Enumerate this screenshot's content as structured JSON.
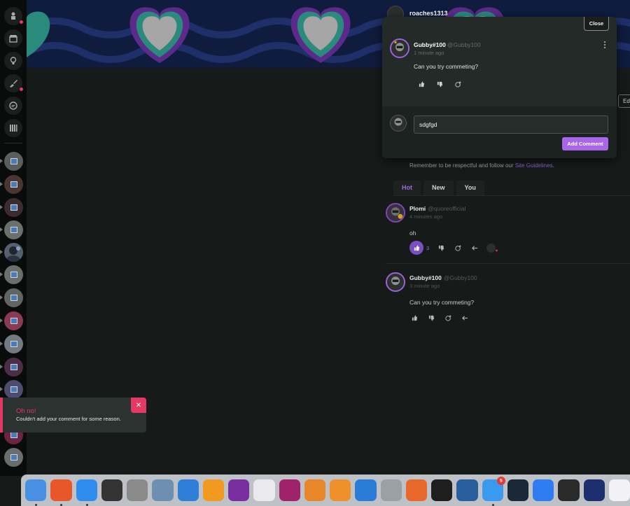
{
  "profile": {
    "username": "roaches1313",
    "edit_label": "Ed"
  },
  "popup": {
    "close_label": "Close",
    "comment": {
      "author": "Gubby#100",
      "handle": "@Gubby100",
      "time": "1 minute ago",
      "text": "Can you try commeting?"
    },
    "input_value": "sdgfgd",
    "add_label": "Add Comment"
  },
  "guidelines": {
    "text": "Remember to be respectful and follow our",
    "link": "Site Guidelines",
    "suffix": "."
  },
  "tabs": [
    {
      "label": "Hot"
    },
    {
      "label": "New"
    },
    {
      "label": "You"
    }
  ],
  "comments": [
    {
      "author": "Plomi",
      "handle": "@quoreofficial",
      "time": "4 minutes ago",
      "text": "oh",
      "likes": "3"
    },
    {
      "author": "Gubby#100",
      "handle": "@Gubby100",
      "time": "3 minute ago",
      "text": "Can you try commeting?"
    }
  ],
  "toast": {
    "title": "Oh no!",
    "message": "Couldn't add your comment for some reason.",
    "close": "✕"
  },
  "dock": {
    "apps": [
      {
        "name": "finder",
        "color": "#4a90e2"
      },
      {
        "name": "firefox",
        "color": "#e8572a"
      },
      {
        "name": "safari",
        "color": "#2f8df0"
      },
      {
        "name": "fl-studio",
        "color": "#333333"
      },
      {
        "name": "calculator",
        "color": "#8a8a8a"
      },
      {
        "name": "preview",
        "color": "#6f8fb0"
      },
      {
        "name": "headphones",
        "color": "#2f7fd8"
      },
      {
        "name": "audacity",
        "color": "#f29a1f"
      },
      {
        "name": "hexagon-app",
        "color": "#7a2fa0"
      },
      {
        "name": "infinity-app",
        "color": "#e9e9ee"
      },
      {
        "name": "monitor-app",
        "color": "#a0226a"
      },
      {
        "name": "blender",
        "color": "#e8872a"
      },
      {
        "name": "sublime-text",
        "color": "#f0902a"
      },
      {
        "name": "vscode",
        "color": "#2b7cd6"
      },
      {
        "name": "disk-utility",
        "color": "#9aa0a6"
      },
      {
        "name": "apex-app",
        "color": "#e8672a"
      },
      {
        "name": "terminal",
        "color": "#1e1e1e"
      },
      {
        "name": "virtualbox",
        "color": "#2a5f9e"
      },
      {
        "name": "messages",
        "color": "#3a9af0",
        "badge": "5"
      },
      {
        "name": "steam",
        "color": "#1b2838"
      },
      {
        "name": "roblox-studio",
        "color": "#2e7cf0"
      },
      {
        "name": "roblox",
        "color": "#2a2a2a"
      },
      {
        "name": "x-app",
        "color": "#1d2f6f"
      },
      {
        "name": "triangle-app",
        "color": "#f2f2f6"
      }
    ]
  }
}
